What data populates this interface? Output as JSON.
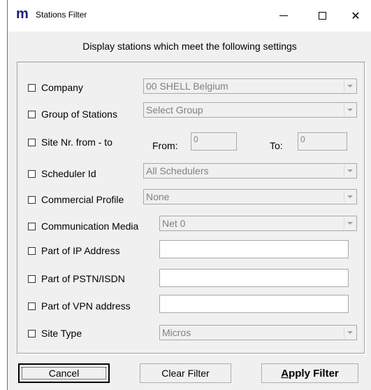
{
  "window": {
    "app_icon": "m",
    "title": "Stations Filter",
    "controls": {
      "minimize": "—",
      "maximize": "☐",
      "close": "✕"
    }
  },
  "header": "Display stations which meet the following settings",
  "filters": {
    "company": {
      "label": "Company",
      "value": "00  SHELL Belgium"
    },
    "group": {
      "label": "Group of Stations",
      "value": "Select Group"
    },
    "site_nr": {
      "label": "Site Nr. from - to",
      "from_label": "From:",
      "from_value": "0",
      "to_label": "To:",
      "to_value": "0"
    },
    "scheduler": {
      "label": "Scheduler Id",
      "value": "All Schedulers"
    },
    "commercial": {
      "label": "Commercial Profile",
      "value": "None"
    },
    "communication": {
      "label": "Communication Media",
      "value": "Net 0"
    },
    "ip": {
      "label": "Part of IP Address",
      "value": ""
    },
    "pstn": {
      "label": "Part of PSTN/ISDN",
      "value": ""
    },
    "vpn": {
      "label": "Part of VPN address",
      "value": ""
    },
    "site_type": {
      "label": "Site Type",
      "value": "Micros"
    }
  },
  "buttons": {
    "cancel": "Cancel",
    "clear": "Clear Filter",
    "apply_accel": "A",
    "apply_rest": "pply Filter"
  }
}
